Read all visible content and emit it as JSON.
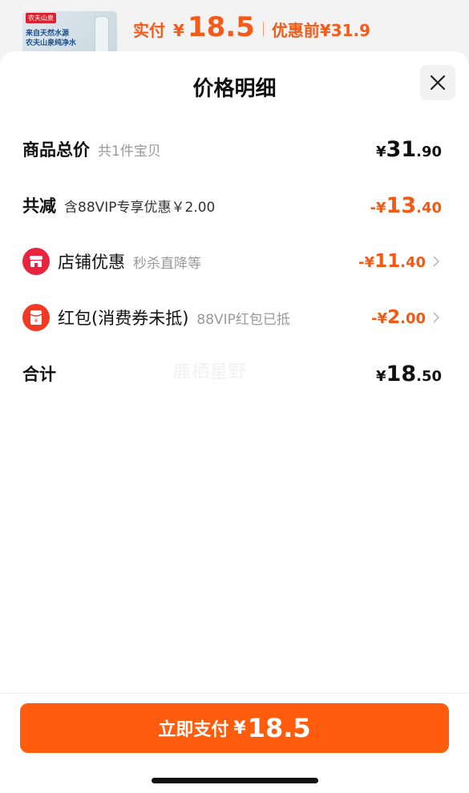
{
  "background": {
    "brand": "农夫山泉",
    "thumb_line1": "来自天然水源",
    "thumb_line2": "农夫山泉纯净水",
    "paid_label": "实付",
    "currency": "¥",
    "paid_amount": "18.5",
    "original_label": "优惠前",
    "original_amount": "¥31.9"
  },
  "sheet": {
    "title": "价格明细",
    "close_icon": "close-icon"
  },
  "rows": [
    {
      "label": "商品总价",
      "note": "共1件宝贝",
      "yen": "¥",
      "int": "31",
      "dec": ".90",
      "sign": "",
      "color": "#111111"
    },
    {
      "label": "共减",
      "note": "含88VIP专享优惠￥2.00",
      "yen": "¥",
      "int": "13",
      "dec": ".40",
      "sign": "-",
      "color": "#f05a14"
    },
    {
      "label": "店铺优惠",
      "note": "秒杀直降等",
      "yen": "¥",
      "int": "11",
      "dec": ".40",
      "sign": "-",
      "icon": "shop-icon",
      "color": "#f05a14"
    },
    {
      "label": "红包(消费券未抵)",
      "note": "88VIP红包已抵",
      "yen": "¥",
      "int": "2",
      "dec": ".00",
      "sign": "-",
      "icon": "red-packet-icon",
      "color": "#f05a14"
    },
    {
      "label": "合计",
      "note": "",
      "yen": "¥",
      "int": "18",
      "dec": ".50",
      "sign": "",
      "color": "#111111"
    }
  ],
  "watermark": "鹿栖星野",
  "pay_button": {
    "label": "立即支付",
    "yen": "¥",
    "amount": "18.5",
    "color": "#ff5c0e"
  }
}
